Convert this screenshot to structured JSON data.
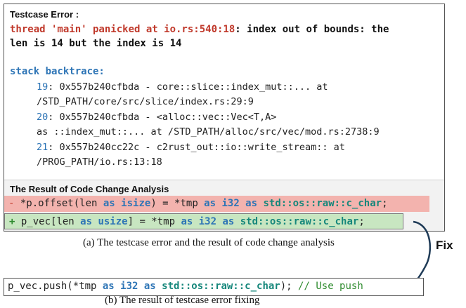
{
  "error": {
    "heading": "Testcase Error :",
    "message_red": "thread 'main' panicked at io.rs:540:18",
    "message_rest_line1": ": index out of bounds: the",
    "message_line2": "len is 14 but the index is 14",
    "backtrace_title": "stack backtrace:",
    "frames": [
      {
        "num": "19",
        "line1": ": 0x557b240cfbda - core::slice::index_mut::... at",
        "line2": "/STD_PATH/core/src/slice/index.rs:29:9"
      },
      {
        "num": "20",
        "line1": ": 0x557b240cfbda - <alloc::vec::Vec<T,A>",
        "line2": "as ::index_mut::... at /STD_PATH/alloc/src/vec/mod.rs:2738:9"
      },
      {
        "num": "21",
        "line1": ": 0x557b240cc22c - c2rust_out::io::write_stream:: at",
        "line2": "/PROG_PATH/io.rs:13:18"
      }
    ]
  },
  "analysis": {
    "heading": "The Result of Code Change Analysis",
    "removed": {
      "sign": "-",
      "pre": " *p.offset(len ",
      "kw1": "as",
      "ty1": " isize",
      "mid": ") = *tmp ",
      "kw2": "as",
      "ty2": " i32",
      "kw3": " as",
      "ty3": " std::os::raw::c_char",
      "end": ";"
    },
    "added": {
      "sign": "+",
      "pre": " p_vec[len ",
      "kw1": "as",
      "ty1": " usize",
      "mid": "] = *tmp ",
      "kw2": "as",
      "ty2": " i32",
      "kw3": " as",
      "ty3": " std::os::raw::c_char",
      "end": ";"
    }
  },
  "caption_a": "(a) The testcase error and the result of code change analysis",
  "fix_label": "Fix",
  "fixed_code": {
    "pre": "p_vec.push(*tmp ",
    "kw1": "as",
    "ty1": " i32",
    "kw2": " as",
    "ty2": " std::os::raw::c_char",
    "end": "); ",
    "comment": "// Use push"
  },
  "caption_b": "(b) The result of testcase error fixing"
}
